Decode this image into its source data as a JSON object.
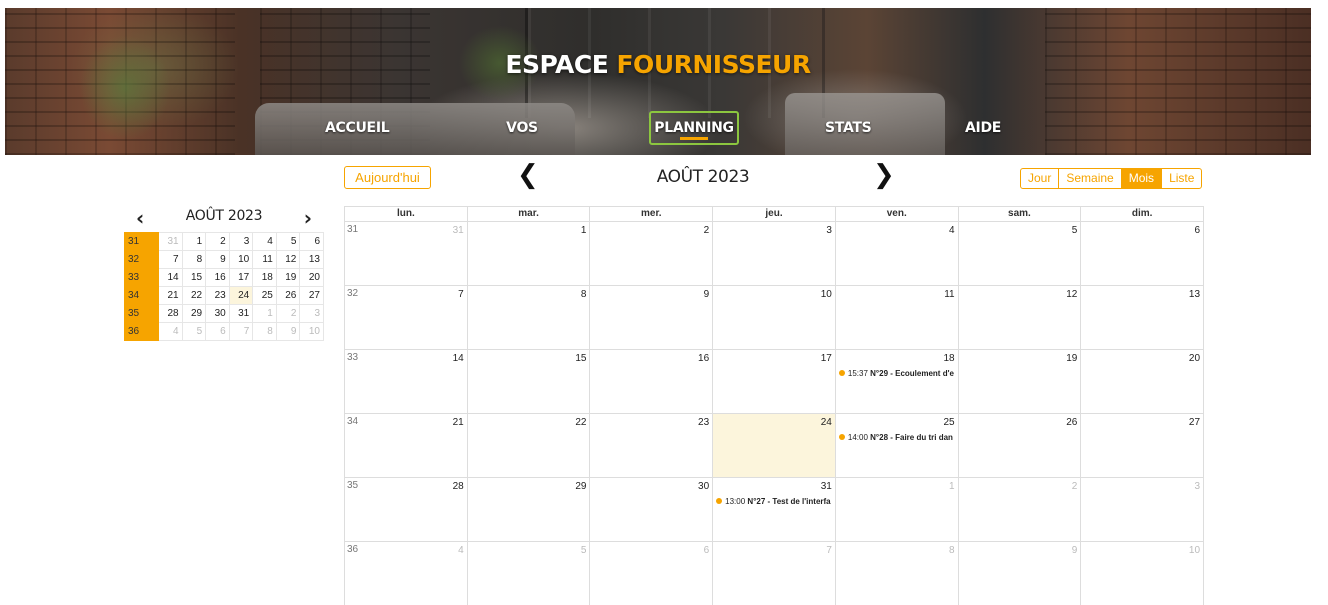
{
  "brand": {
    "part1": "ESPACE ",
    "part2": "FOURNISSEUR",
    "accent_color": "#f6a400"
  },
  "nav": [
    {
      "label": "ACCUEIL",
      "active": false
    },
    {
      "label": "VOS TICKETS",
      "active": false
    },
    {
      "label": "PLANNING",
      "active": true
    },
    {
      "label": "STATS",
      "active": false
    },
    {
      "label": "AIDE",
      "active": false
    }
  ],
  "mini_calendar": {
    "title": "AOÛT 2023",
    "prev_icon": "chevron-left-icon",
    "next_icon": "chevron-right-icon",
    "weeks": [
      {
        "week": "31",
        "days": [
          "31",
          "1",
          "2",
          "3",
          "4",
          "5",
          "6"
        ]
      },
      {
        "week": "32",
        "days": [
          "7",
          "8",
          "9",
          "10",
          "11",
          "12",
          "13"
        ]
      },
      {
        "week": "33",
        "days": [
          "14",
          "15",
          "16",
          "17",
          "18",
          "19",
          "20"
        ]
      },
      {
        "week": "34",
        "days": [
          "21",
          "22",
          "23",
          "24",
          "25",
          "26",
          "27"
        ]
      },
      {
        "week": "35",
        "days": [
          "28",
          "29",
          "30",
          "31",
          "1",
          "2",
          "3"
        ]
      },
      {
        "week": "36",
        "days": [
          "4",
          "5",
          "6",
          "7",
          "8",
          "9",
          "10"
        ]
      }
    ]
  },
  "toolbar": {
    "today_label": "Aujourd'hui",
    "title": "AOÛT 2023",
    "views": [
      {
        "label": "Jour",
        "active": false
      },
      {
        "label": "Semaine",
        "active": false
      },
      {
        "label": "Mois",
        "active": true
      },
      {
        "label": "Liste",
        "active": false
      }
    ]
  },
  "calendar": {
    "weekdays": [
      "lun.",
      "mar.",
      "mer.",
      "jeu.",
      "ven.",
      "sam.",
      "dim."
    ],
    "weeks": [
      {
        "week": "31",
        "days": [
          {
            "num": "31",
            "other": true
          },
          {
            "num": "1"
          },
          {
            "num": "2"
          },
          {
            "num": "3"
          },
          {
            "num": "4"
          },
          {
            "num": "5"
          },
          {
            "num": "6"
          }
        ]
      },
      {
        "week": "32",
        "days": [
          {
            "num": "7"
          },
          {
            "num": "8"
          },
          {
            "num": "9"
          },
          {
            "num": "10"
          },
          {
            "num": "11"
          },
          {
            "num": "12"
          },
          {
            "num": "13"
          }
        ]
      },
      {
        "week": "33",
        "days": [
          {
            "num": "14"
          },
          {
            "num": "15"
          },
          {
            "num": "16"
          },
          {
            "num": "17"
          },
          {
            "num": "18",
            "event": {
              "time": "15:37",
              "ticket": "N°29",
              "title": " - Ecoulement d'e"
            }
          },
          {
            "num": "19"
          },
          {
            "num": "20"
          }
        ]
      },
      {
        "week": "34",
        "days": [
          {
            "num": "21"
          },
          {
            "num": "22"
          },
          {
            "num": "23"
          },
          {
            "num": "24",
            "today": true
          },
          {
            "num": "25",
            "event": {
              "time": "14:00",
              "ticket": "N°28",
              "title": " - Faire du tri dan"
            }
          },
          {
            "num": "26"
          },
          {
            "num": "27"
          }
        ]
      },
      {
        "week": "35",
        "days": [
          {
            "num": "28"
          },
          {
            "num": "29"
          },
          {
            "num": "30"
          },
          {
            "num": "31",
            "event": {
              "time": "13:00",
              "ticket": "N°27",
              "title": " - Test de l'interfa"
            }
          },
          {
            "num": "1",
            "other": true
          },
          {
            "num": "2",
            "other": true
          },
          {
            "num": "3",
            "other": true
          }
        ]
      },
      {
        "week": "36",
        "days": [
          {
            "num": "4",
            "other": true
          },
          {
            "num": "5",
            "other": true
          },
          {
            "num": "6",
            "other": true
          },
          {
            "num": "7",
            "other": true
          },
          {
            "num": "8",
            "other": true
          },
          {
            "num": "9",
            "other": true
          },
          {
            "num": "10",
            "other": true
          }
        ]
      }
    ]
  }
}
